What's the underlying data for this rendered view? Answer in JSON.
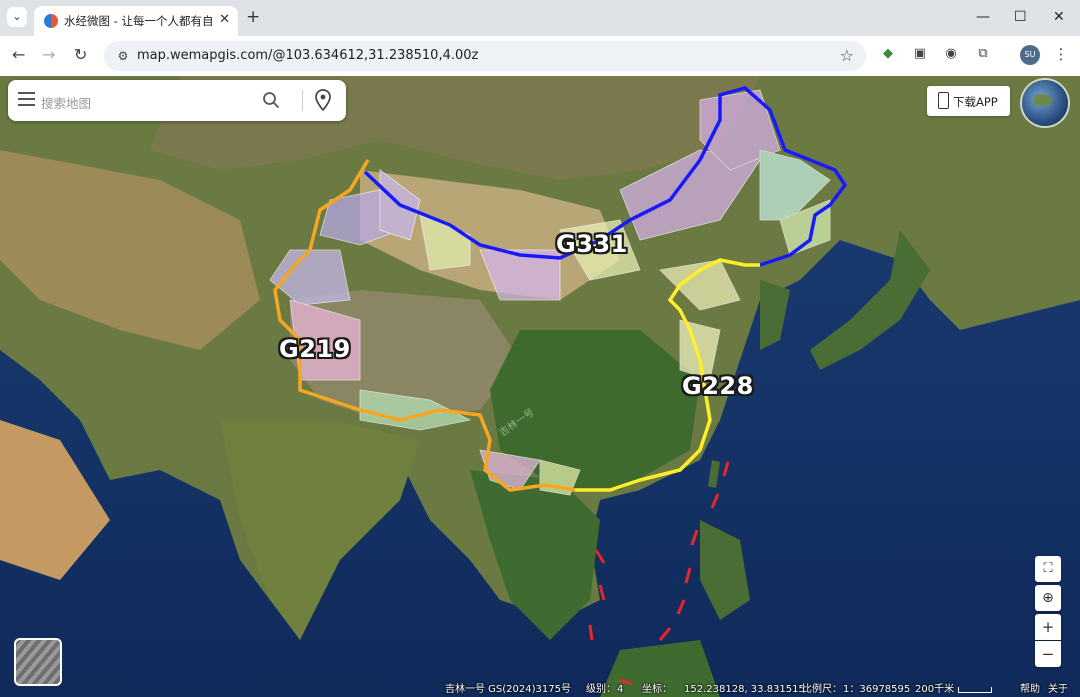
{
  "browser": {
    "tab_title": "水经微图 - 让每一个人都有自己",
    "url": "map.wemapgis.com/@103.634612,31.238510,4.00z",
    "profile_initials": "SU"
  },
  "search": {
    "placeholder": "搜索地图"
  },
  "download_label": "下载APP",
  "roads": {
    "g331": "G331",
    "g219": "G219",
    "g228": "G228"
  },
  "watermark": "吉林一号",
  "colors": {
    "g331_route": "#1a1aff",
    "g219_route": "#f5a623",
    "g228_route": "#ffee2a",
    "boundary_dash": "#e8262b"
  },
  "controls": {
    "zoom_in": "+",
    "zoom_out": "−"
  },
  "status": {
    "source": "吉林一号 GS(2024)3175号",
    "level_label": "级别：",
    "level_value": "4",
    "coord_label": "坐标：",
    "coord_value": "152.238128, 33.831515",
    "scale_label": "比例尺：",
    "scale_value": "1：36978595",
    "scale_distance": "200千米",
    "help": "帮助",
    "about": "关于"
  }
}
